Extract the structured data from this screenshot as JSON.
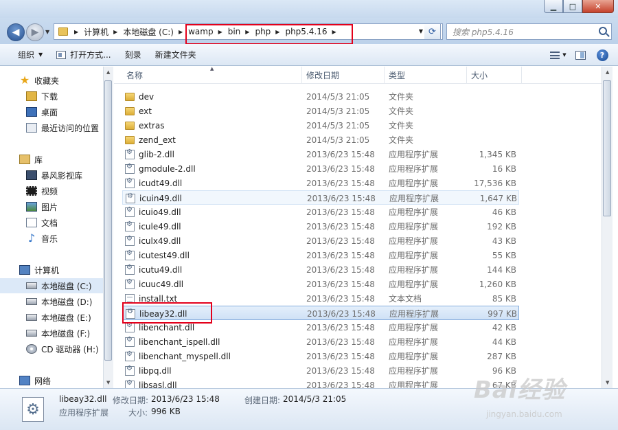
{
  "address": {
    "crumbs": [
      "计算机",
      "本地磁盘 (C:)",
      "wamp",
      "bin",
      "php",
      "php5.4.16"
    ]
  },
  "search": {
    "placeholder": "搜索 php5.4.16"
  },
  "toolbar": {
    "organize": "组织",
    "open_with": "打开方式...",
    "burn": "刻录",
    "new_folder": "新建文件夹"
  },
  "nav": {
    "items": [
      {
        "label": "收藏夹",
        "icon": "star-icon"
      },
      {
        "label": "下载",
        "icon": "downloads-icon"
      },
      {
        "label": "桌面",
        "icon": "desktop-icon"
      },
      {
        "label": "最近访问的位置",
        "icon": "recent-places-icon"
      },
      {
        "label": "库",
        "icon": "libraries-icon"
      },
      {
        "label": "暴风影视库",
        "icon": "video-library-icon"
      },
      {
        "label": "视频",
        "icon": "video-icon"
      },
      {
        "label": "图片",
        "icon": "pictures-icon"
      },
      {
        "label": "文档",
        "icon": "documents-icon"
      },
      {
        "label": "音乐",
        "icon": "music-icon"
      },
      {
        "label": "计算机",
        "icon": "computer-icon"
      },
      {
        "label": "本地磁盘 (C:)",
        "icon": "drive-icon"
      },
      {
        "label": "本地磁盘 (D:)",
        "icon": "drive-icon"
      },
      {
        "label": "本地磁盘 (E:)",
        "icon": "drive-icon"
      },
      {
        "label": "本地磁盘 (F:)",
        "icon": "drive-icon"
      },
      {
        "label": "CD 驱动器 (H:)",
        "icon": "cd-drive-icon"
      },
      {
        "label": "网络",
        "icon": "network-icon"
      }
    ]
  },
  "columns": {
    "name": "名称",
    "date": "修改日期",
    "type": "类型",
    "size": "大小"
  },
  "files": [
    {
      "name": "dev",
      "date": "2014/5/3 21:05",
      "type": "文件夹",
      "size": "",
      "kind": "folder"
    },
    {
      "name": "ext",
      "date": "2014/5/3 21:05",
      "type": "文件夹",
      "size": "",
      "kind": "folder"
    },
    {
      "name": "extras",
      "date": "2014/5/3 21:05",
      "type": "文件夹",
      "size": "",
      "kind": "folder"
    },
    {
      "name": "zend_ext",
      "date": "2014/5/3 21:05",
      "type": "文件夹",
      "size": "",
      "kind": "folder"
    },
    {
      "name": "glib-2.dll",
      "date": "2013/6/23 15:48",
      "type": "应用程序扩展",
      "size": "1,345 KB",
      "kind": "dll"
    },
    {
      "name": "gmodule-2.dll",
      "date": "2013/6/23 15:48",
      "type": "应用程序扩展",
      "size": "16 KB",
      "kind": "dll"
    },
    {
      "name": "icudt49.dll",
      "date": "2013/6/23 15:48",
      "type": "应用程序扩展",
      "size": "17,536 KB",
      "kind": "dll"
    },
    {
      "name": "icuin49.dll",
      "date": "2013/6/23 15:48",
      "type": "应用程序扩展",
      "size": "1,647 KB",
      "kind": "dll"
    },
    {
      "name": "icuio49.dll",
      "date": "2013/6/23 15:48",
      "type": "应用程序扩展",
      "size": "46 KB",
      "kind": "dll"
    },
    {
      "name": "icule49.dll",
      "date": "2013/6/23 15:48",
      "type": "应用程序扩展",
      "size": "192 KB",
      "kind": "dll"
    },
    {
      "name": "iculx49.dll",
      "date": "2013/6/23 15:48",
      "type": "应用程序扩展",
      "size": "43 KB",
      "kind": "dll"
    },
    {
      "name": "icutest49.dll",
      "date": "2013/6/23 15:48",
      "type": "应用程序扩展",
      "size": "55 KB",
      "kind": "dll"
    },
    {
      "name": "icutu49.dll",
      "date": "2013/6/23 15:48",
      "type": "应用程序扩展",
      "size": "144 KB",
      "kind": "dll"
    },
    {
      "name": "icuuc49.dll",
      "date": "2013/6/23 15:48",
      "type": "应用程序扩展",
      "size": "1,260 KB",
      "kind": "dll"
    },
    {
      "name": "install.txt",
      "date": "2013/6/23 15:48",
      "type": "文本文档",
      "size": "85 KB",
      "kind": "txt"
    },
    {
      "name": "libeay32.dll",
      "date": "2013/6/23 15:48",
      "type": "应用程序扩展",
      "size": "997 KB",
      "kind": "dll"
    },
    {
      "name": "libenchant.dll",
      "date": "2013/6/23 15:48",
      "type": "应用程序扩展",
      "size": "42 KB",
      "kind": "dll"
    },
    {
      "name": "libenchant_ispell.dll",
      "date": "2013/6/23 15:48",
      "type": "应用程序扩展",
      "size": "44 KB",
      "kind": "dll"
    },
    {
      "name": "libenchant_myspell.dll",
      "date": "2013/6/23 15:48",
      "type": "应用程序扩展",
      "size": "287 KB",
      "kind": "dll"
    },
    {
      "name": "libpq.dll",
      "date": "2013/6/23 15:48",
      "type": "应用程序扩展",
      "size": "96 KB",
      "kind": "dll"
    },
    {
      "name": "libsasl.dll",
      "date": "2013/6/23 15:48",
      "type": "应用程序扩展",
      "size": "67 KB",
      "kind": "dll"
    }
  ],
  "details": {
    "name": "libeay32.dll",
    "modified_label": "修改日期:",
    "modified": "2013/6/23 15:48",
    "created_label": "创建日期:",
    "created": "2014/5/3 21:05",
    "type": "应用程序扩展",
    "size_label": "大小:",
    "size": "996 KB"
  },
  "watermark": {
    "text": "Bai经验",
    "sub": "jingyan.baidu.com"
  }
}
